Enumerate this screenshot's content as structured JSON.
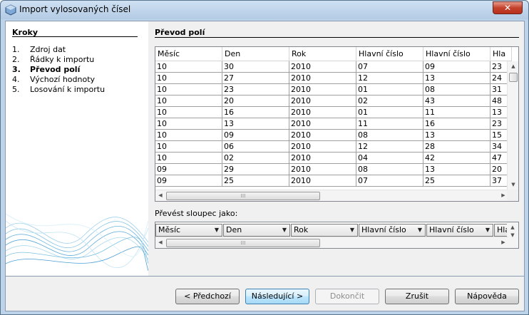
{
  "window": {
    "title": "Import vylosovaných čísel",
    "close_glyph": "✕"
  },
  "steps": {
    "title": "Kroky",
    "items": [
      {
        "num": "1.",
        "label": "Zdroj dat"
      },
      {
        "num": "2.",
        "label": "Řádky k importu"
      },
      {
        "num": "3.",
        "label": "Převod polí"
      },
      {
        "num": "4.",
        "label": "Výchozí hodnoty"
      },
      {
        "num": "5.",
        "label": "Losování k importu"
      }
    ],
    "active_index": 2
  },
  "main": {
    "section_title": "Převod polí",
    "grid": {
      "headers": [
        "Měsíc",
        "Den",
        "Rok",
        "Hlavní číslo",
        "Hlavní číslo",
        "Hla"
      ],
      "rows": [
        [
          "10",
          "30",
          "2010",
          "07",
          "09",
          "23"
        ],
        [
          "10",
          "27",
          "2010",
          "12",
          "13",
          "24"
        ],
        [
          "10",
          "23",
          "2010",
          "01",
          "08",
          "31"
        ],
        [
          "10",
          "20",
          "2010",
          "02",
          "43",
          "48"
        ],
        [
          "10",
          "16",
          "2010",
          "01",
          "11",
          "13"
        ],
        [
          "10",
          "13",
          "2010",
          "11",
          "16",
          "23"
        ],
        [
          "10",
          "09",
          "2010",
          "08",
          "13",
          "15"
        ],
        [
          "10",
          "06",
          "2010",
          "12",
          "28",
          "34"
        ],
        [
          "10",
          "02",
          "2010",
          "04",
          "42",
          "47"
        ],
        [
          "09",
          "29",
          "2010",
          "08",
          "13",
          "20"
        ],
        [
          "09",
          "25",
          "2010",
          "07",
          "25",
          "37"
        ]
      ]
    },
    "convert_label": "Převést sloupec jako:",
    "convert_types": [
      "Měsíc",
      "Den",
      "Rok",
      "Hlavní číslo",
      "Hlavní číslo",
      "Hla"
    ]
  },
  "buttons": {
    "previous": "< Předchozí",
    "next": "Následující >",
    "finish": "Dokončit",
    "cancel": "Zrušit",
    "help": "Nápověda"
  }
}
